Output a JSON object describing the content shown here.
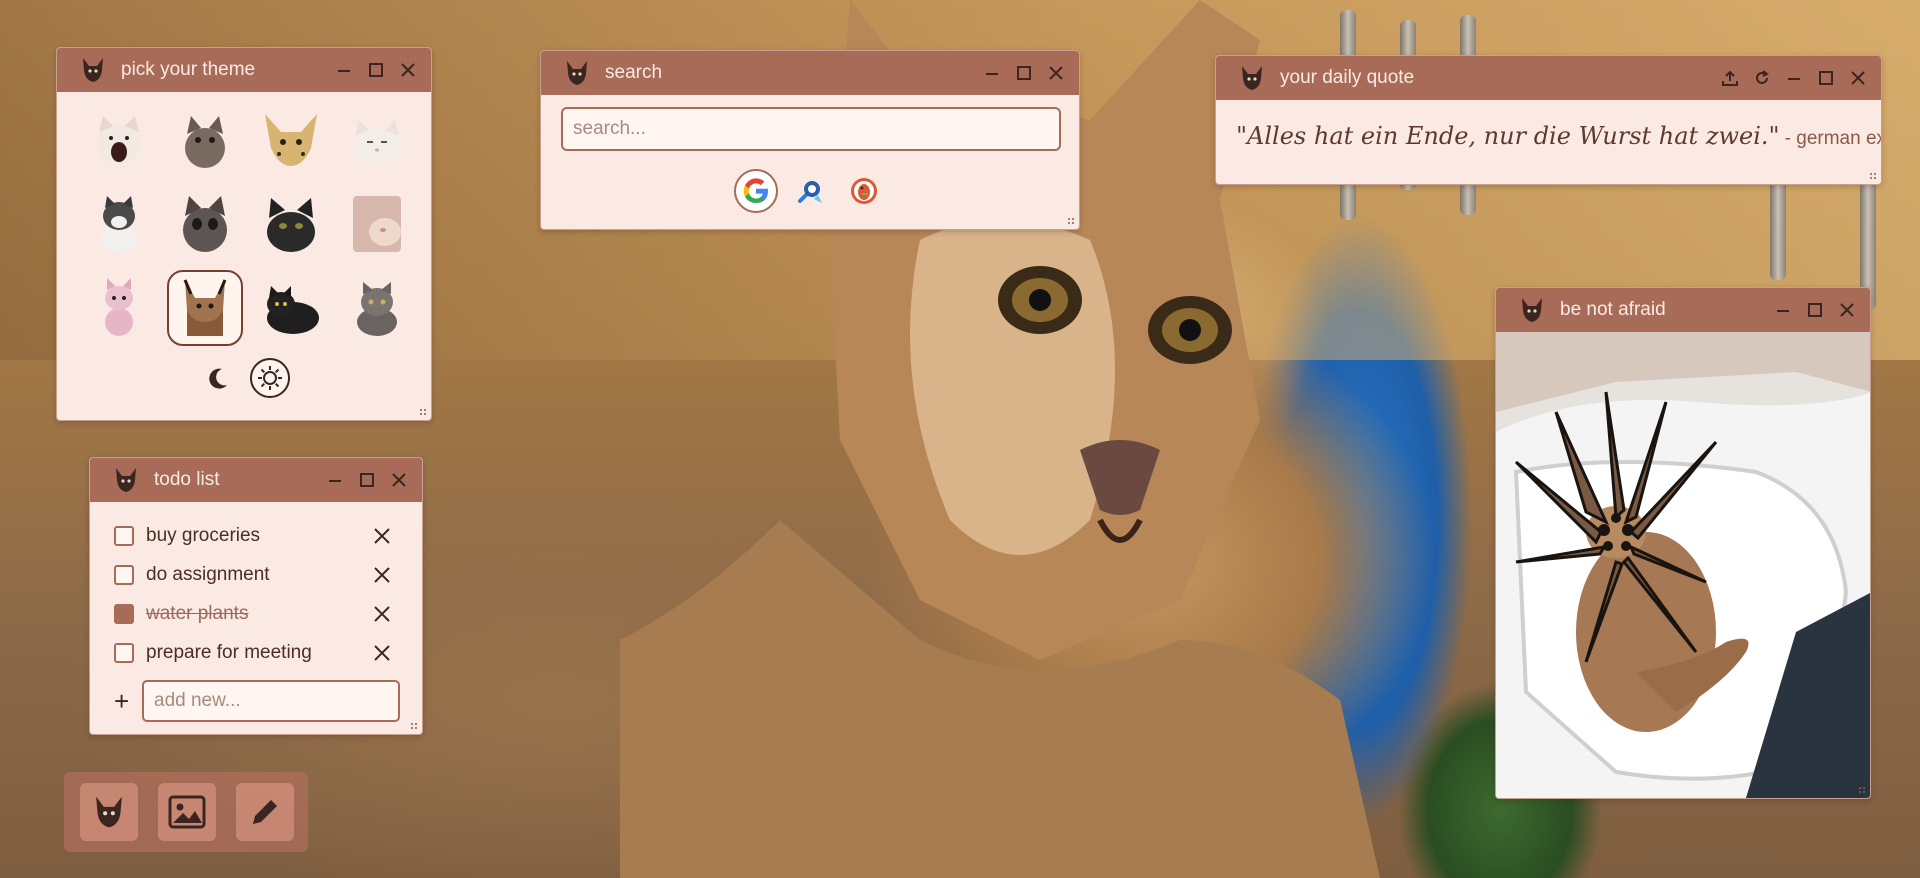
{
  "theme_window": {
    "title": "pick your theme",
    "themes": [
      "popcat",
      "smudge-cat",
      "serval",
      "smirk-cat",
      "sitting-cat",
      "crying-cat",
      "black-cat-staring",
      "blurry-cat",
      "pink-cat",
      "floppa",
      "black-cat-loaf",
      "grumpy-tabby"
    ],
    "selected_theme": "floppa",
    "modes": [
      "dark-mode",
      "light-mode"
    ],
    "active_mode": "light-mode"
  },
  "search_window": {
    "title": "search",
    "placeholder": "search...",
    "engines": [
      "google",
      "other-search",
      "duckduckgo"
    ],
    "active_engine": "google"
  },
  "quote_window": {
    "title": "your daily quote",
    "quote": "\"Alles hat ein Ende, nur die Wurst hat zwei.\"",
    "author": "- german expression"
  },
  "todo_window": {
    "title": "todo list",
    "items": [
      {
        "text": "buy groceries",
        "done": false
      },
      {
        "text": "do assignment",
        "done": false
      },
      {
        "text": "water plants",
        "done": true
      },
      {
        "text": "prepare for meeting",
        "done": false
      }
    ],
    "add_symbol": "+",
    "add_placeholder": "add new..."
  },
  "image_window": {
    "title": "be not afraid"
  },
  "dock": {
    "items": [
      "cat-logo",
      "image",
      "pencil"
    ]
  },
  "colors": {
    "titlebar": "#a86b58",
    "window_bg": "#fbeae3",
    "accent_dark": "#3b2520"
  }
}
